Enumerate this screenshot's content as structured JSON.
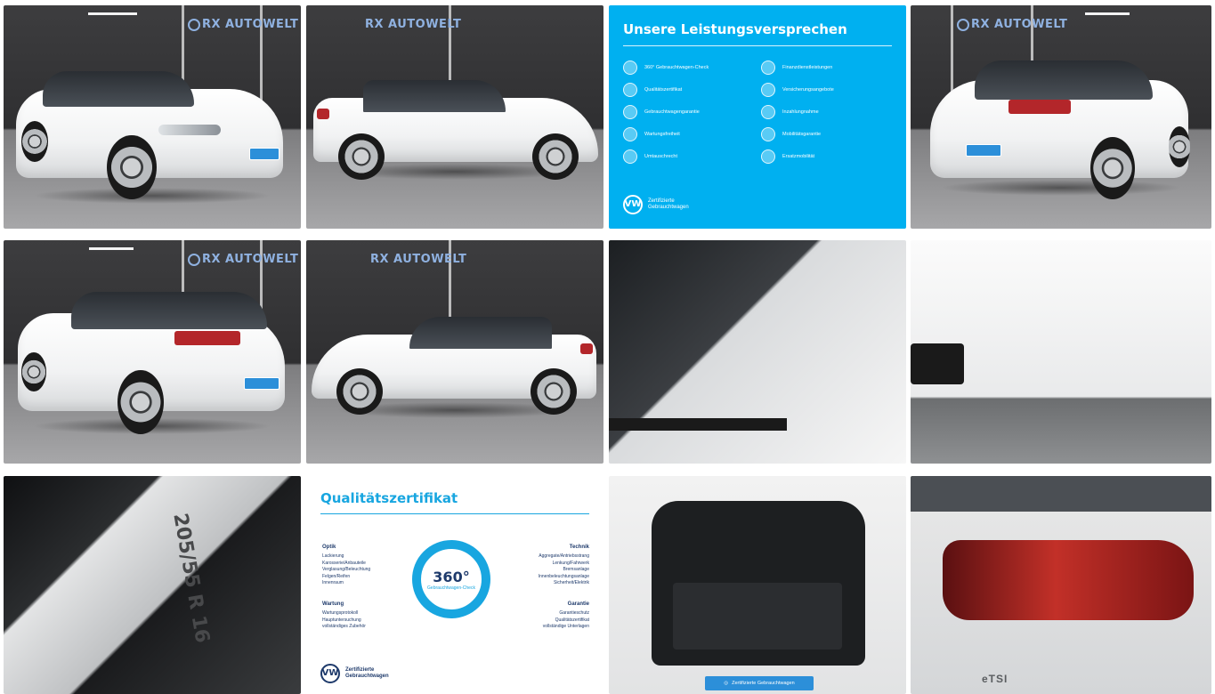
{
  "gallery": {
    "showroom_logo": "RX AUTOWELT",
    "promise_tile": {
      "title": "Unsere Leistungsversprechen",
      "items": [
        "360° Gebrauchtwagen-Check",
        "Finanzdienstleistungen",
        "Qualitätszertifikat",
        "Versicherungsangebote",
        "Gebrauchtwagengarantie",
        "Inzahlungnahme",
        "Wartungsfreiheit",
        "Mobilitätsgarantie",
        "Umtauschrecht",
        "Ersatzmobilität"
      ],
      "brand_line1": "Zertifizierte",
      "brand_line2": "Gebrauchtwagen"
    },
    "certificate_tile": {
      "title": "Qualitätszertifikat",
      "ring_value": "360°",
      "ring_sub": "Gebrauchtwagen-Check",
      "optik": {
        "heading": "Optik",
        "lines": [
          "Lackierung",
          "Karosserie/Anbauteile",
          "Verglasung/Beleuchtung",
          "Felgen/Reifen",
          "Innenraum"
        ]
      },
      "wartung": {
        "heading": "Wartung",
        "lines": [
          "Wartungsprotokoll",
          "Hauptuntersuchung",
          "vollständiges Zubehör"
        ]
      },
      "technik": {
        "heading": "Technik",
        "lines": [
          "Aggregate/Antriebsstrang",
          "Lenkung/Fahrwerk",
          "Bremsanlage",
          "Innenbeleuchtungsanlage",
          "Sicherheit/Elektrik"
        ]
      },
      "garantie": {
        "heading": "Garantie",
        "lines": [
          "Garantieschutz",
          "Qualitätszertifikat",
          "vollständige Unterlagen"
        ]
      },
      "brand_line1": "Zertifizierte",
      "brand_line2": "Gebrauchtwagen"
    },
    "tire_text": "205/55 R 16",
    "trunk_banner": "Zertifizierte Gebrauchtwagen",
    "badge_text": "eTSI"
  }
}
